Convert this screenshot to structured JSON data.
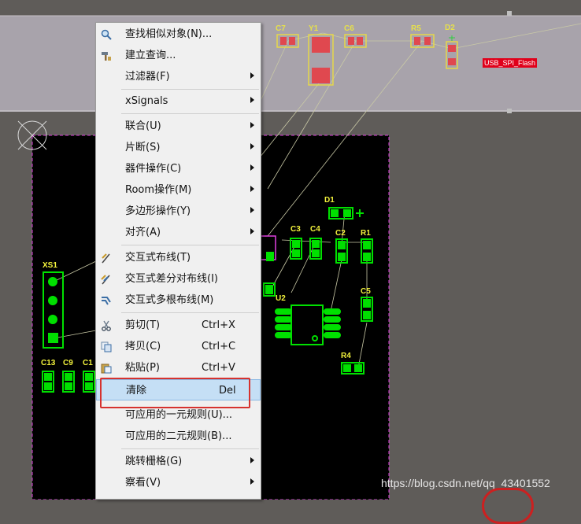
{
  "board": {
    "room_label": "USB_SPI_Flash",
    "designators": {
      "c7": "C7",
      "y1": "Y1",
      "c6": "C6",
      "r5": "R5",
      "d2": "D2",
      "d1": "D1",
      "c3": "C3",
      "c4": "C4",
      "c2": "C2",
      "r1": "R1",
      "u2": "U2",
      "c5": "C5",
      "r4": "R4",
      "xs1": "XS1",
      "c13": "C13",
      "c9": "C9",
      "c11": "C1"
    },
    "colors": {
      "board": "#000000",
      "room": "#a8a3ab",
      "pads": "#00e000",
      "highlight_outline": "#e040e0",
      "room_label_bg": "#e0001a"
    }
  },
  "context_menu": {
    "items": [
      {
        "id": "find-similar",
        "icon": "search-icon",
        "label": "查找相似对象(N)...",
        "shortcut": "",
        "submenu": false
      },
      {
        "id": "build-query",
        "icon": "hammer-icon",
        "label": "建立查询...",
        "shortcut": "",
        "submenu": false
      },
      {
        "id": "filter",
        "icon": "",
        "label": "过滤器(F)",
        "shortcut": "",
        "submenu": true
      },
      {
        "id": "xsignals",
        "icon": "",
        "label": "xSignals",
        "shortcut": "",
        "submenu": true
      },
      {
        "id": "union",
        "icon": "",
        "label": "联合(U)",
        "shortcut": "",
        "submenu": true
      },
      {
        "id": "fragment",
        "icon": "",
        "label": "片断(S)",
        "shortcut": "",
        "submenu": true
      },
      {
        "id": "component-ops",
        "icon": "",
        "label": "器件操作(C)",
        "shortcut": "",
        "submenu": true
      },
      {
        "id": "room-ops",
        "icon": "",
        "label": "Room操作(M)",
        "shortcut": "",
        "submenu": true
      },
      {
        "id": "polygon-ops",
        "icon": "",
        "label": "多边形操作(Y)",
        "shortcut": "",
        "submenu": true
      },
      {
        "id": "align",
        "icon": "",
        "label": "对齐(A)",
        "shortcut": "",
        "submenu": true
      },
      {
        "id": "interactive-route",
        "icon": "route-icon",
        "label": "交互式布线(T)",
        "shortcut": "",
        "submenu": false
      },
      {
        "id": "diff-pair-route",
        "icon": "diff-pair-icon",
        "label": "交互式差分对布线(I)",
        "shortcut": "",
        "submenu": false
      },
      {
        "id": "multi-route",
        "icon": "multi-route-icon",
        "label": "交互式多根布线(M)",
        "shortcut": "",
        "submenu": false
      },
      {
        "id": "cut",
        "icon": "scissors-icon",
        "label": "剪切(T)",
        "shortcut": "Ctrl+X",
        "submenu": false
      },
      {
        "id": "copy",
        "icon": "copy-icon",
        "label": "拷贝(C)",
        "shortcut": "Ctrl+C",
        "submenu": false
      },
      {
        "id": "paste",
        "icon": "paste-icon",
        "label": "粘贴(P)",
        "shortcut": "Ctrl+V",
        "submenu": false
      },
      {
        "id": "clear",
        "icon": "",
        "label": "清除",
        "shortcut": "Del",
        "submenu": false
      },
      {
        "id": "applicable-unary",
        "icon": "",
        "label": "可应用的一元规则(U)...",
        "shortcut": "",
        "submenu": false
      },
      {
        "id": "applicable-binary",
        "icon": "",
        "label": "可应用的二元规则(B)...",
        "shortcut": "",
        "submenu": false
      },
      {
        "id": "jump-grid",
        "icon": "",
        "label": "跳转栅格(G)",
        "shortcut": "",
        "submenu": true
      },
      {
        "id": "view",
        "icon": "",
        "label": "察看(V)",
        "shortcut": "",
        "submenu": true
      }
    ],
    "highlighted": "clear"
  },
  "watermark": "https://blog.csdn.net/qq_43401552"
}
